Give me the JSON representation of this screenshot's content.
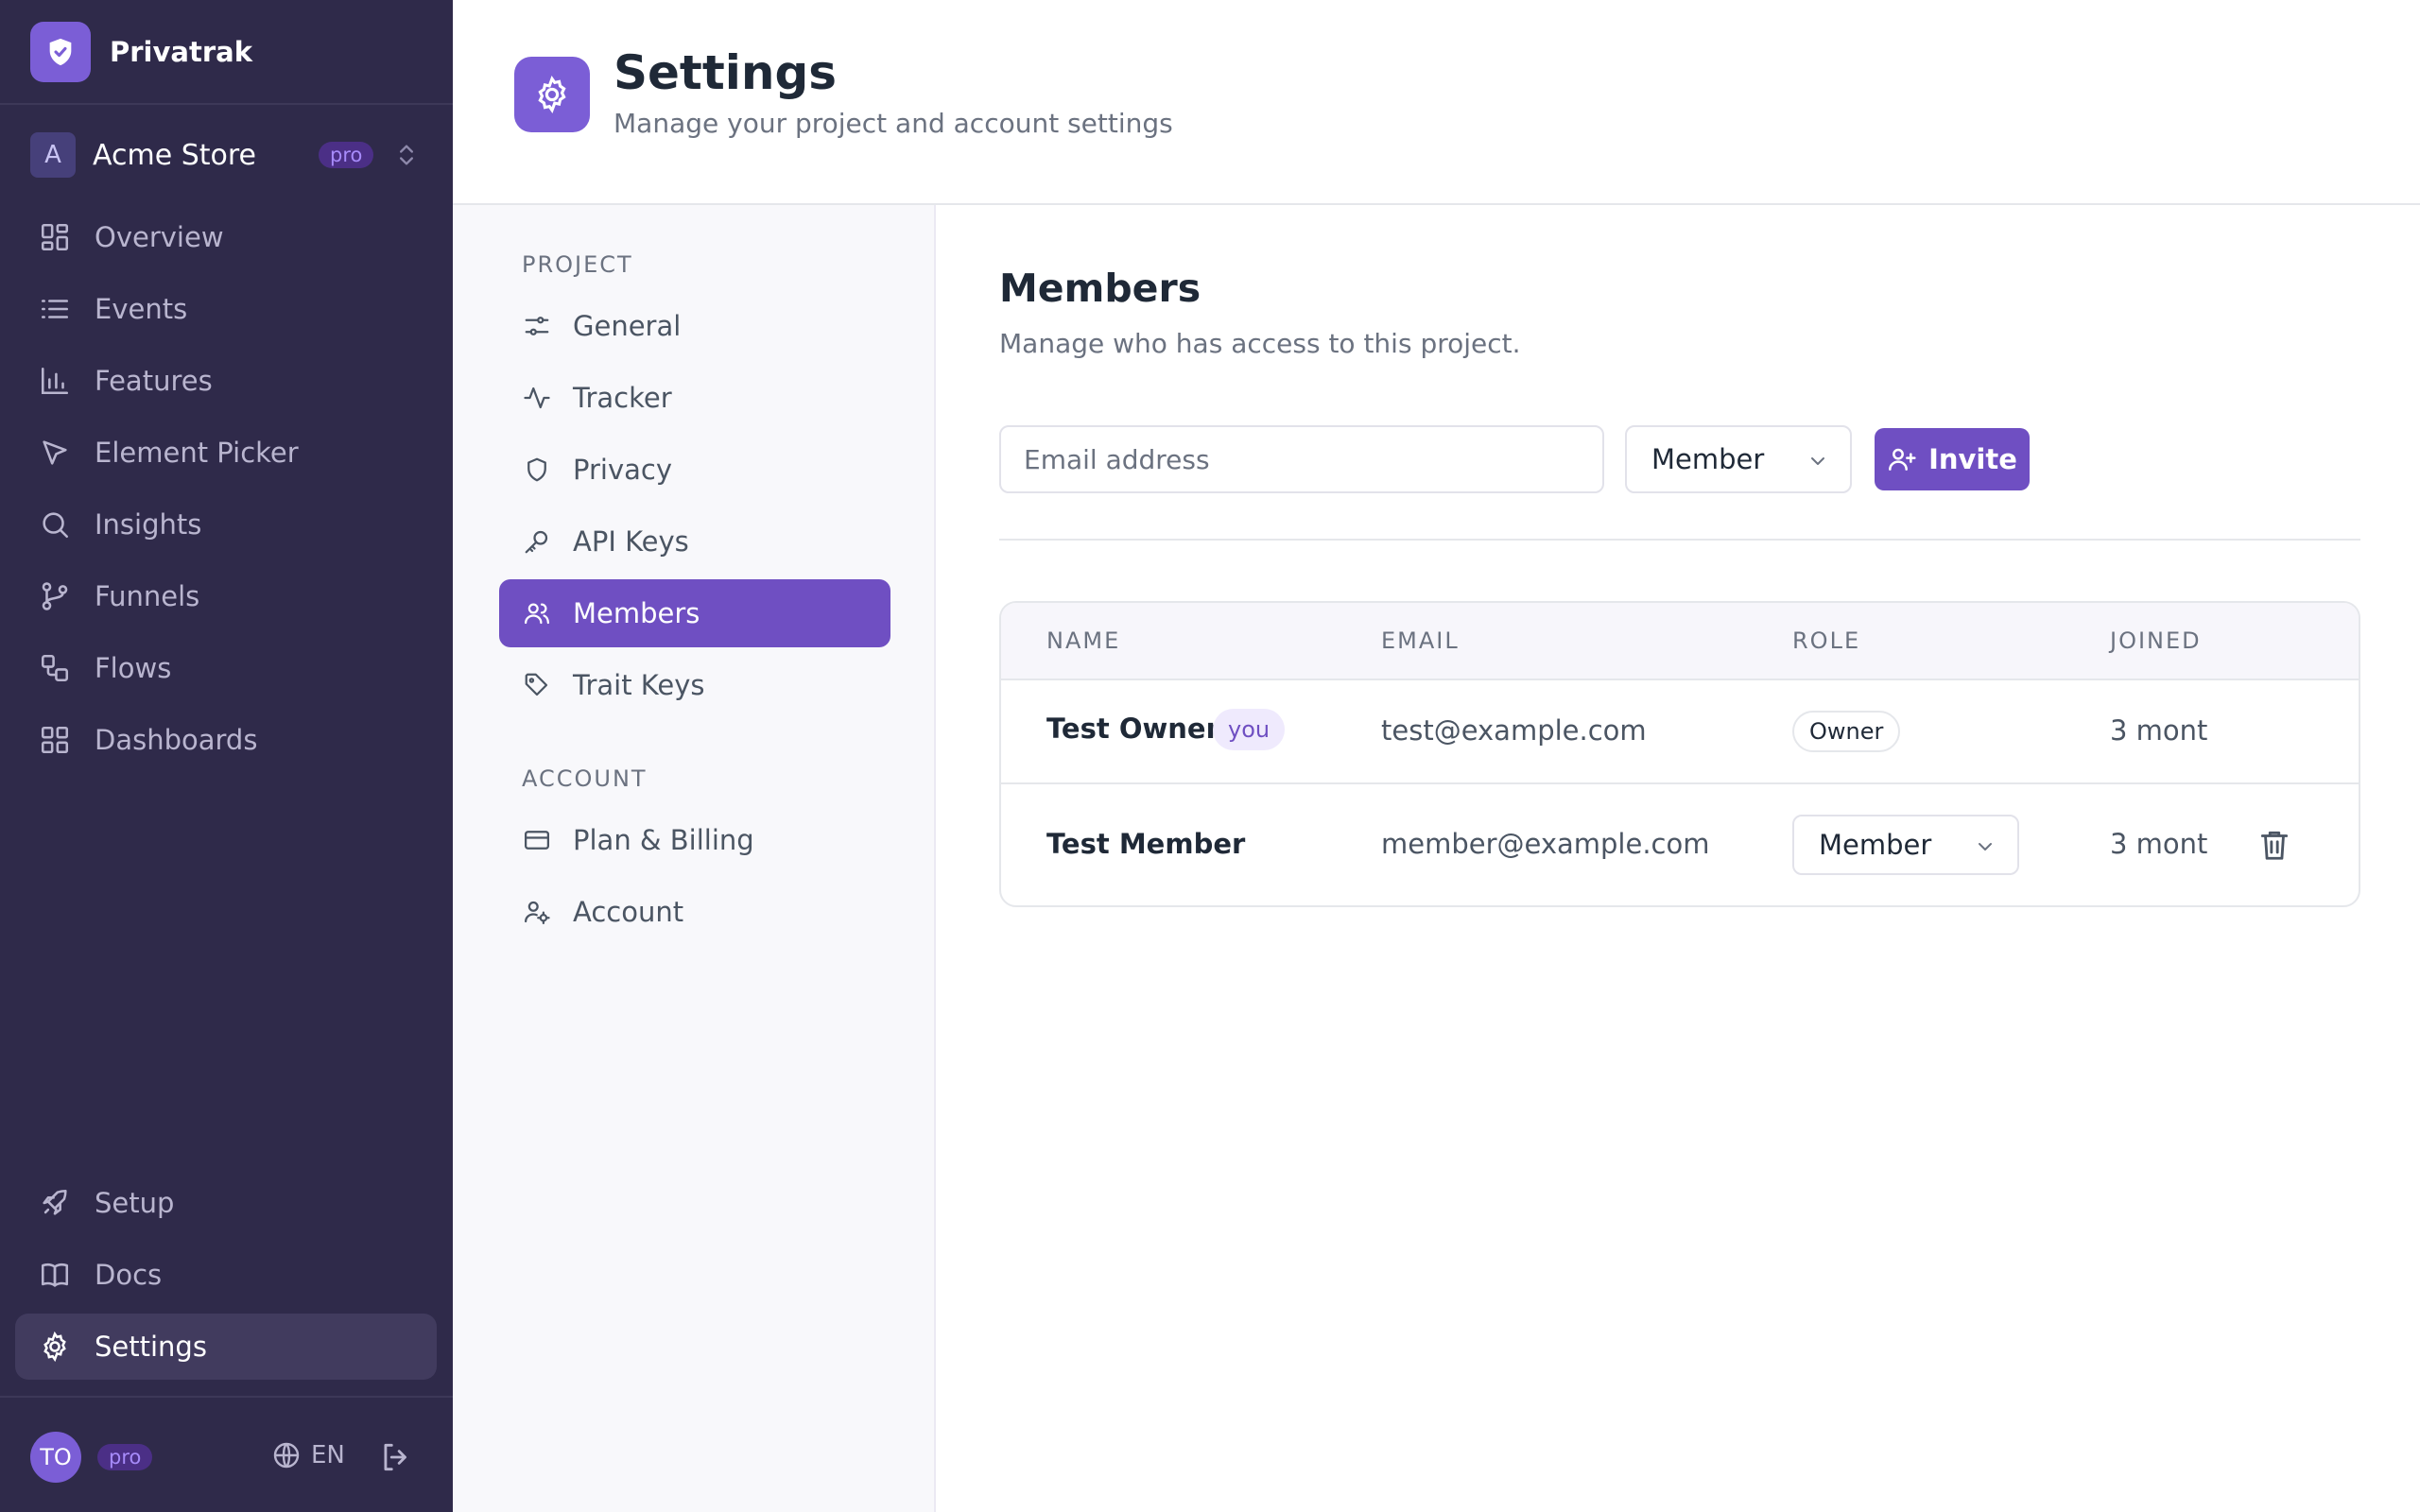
{
  "app": {
    "name": "Privatrak"
  },
  "project": {
    "avatar": "A",
    "name": "Acme Store",
    "plan_badge": "pro"
  },
  "nav": [
    {
      "label": "Overview",
      "icon": "grid-icon"
    },
    {
      "label": "Events",
      "icon": "list-icon"
    },
    {
      "label": "Features",
      "icon": "bar-chart-icon"
    },
    {
      "label": "Element Picker",
      "icon": "cursor-icon"
    },
    {
      "label": "Insights",
      "icon": "search-icon"
    },
    {
      "label": "Funnels",
      "icon": "git-branch-icon"
    },
    {
      "label": "Flows",
      "icon": "workflow-icon"
    },
    {
      "label": "Dashboards",
      "icon": "dashboard-icon"
    }
  ],
  "nav_bottom": [
    {
      "label": "Setup",
      "icon": "rocket-icon"
    },
    {
      "label": "Docs",
      "icon": "book-icon"
    },
    {
      "label": "Settings",
      "icon": "gear-icon",
      "active": true
    }
  ],
  "footer": {
    "user_initials": "TO",
    "plan_badge": "pro",
    "language": "EN"
  },
  "header": {
    "title": "Settings",
    "subtitle": "Manage your project and account settings"
  },
  "settings_nav": {
    "project_heading": "PROJECT",
    "project_items": [
      {
        "label": "General",
        "icon": "sliders-icon"
      },
      {
        "label": "Tracker",
        "icon": "activity-icon"
      },
      {
        "label": "Privacy",
        "icon": "shield-icon"
      },
      {
        "label": "API Keys",
        "icon": "key-icon"
      },
      {
        "label": "Members",
        "icon": "users-icon",
        "active": true
      },
      {
        "label": "Trait Keys",
        "icon": "tag-icon"
      }
    ],
    "account_heading": "ACCOUNT",
    "account_items": [
      {
        "label": "Plan & Billing",
        "icon": "credit-card-icon"
      },
      {
        "label": "Account",
        "icon": "user-cog-icon"
      }
    ]
  },
  "members": {
    "title": "Members",
    "subtitle": "Manage who has access to this project.",
    "email_placeholder": "Email address",
    "role_value": "Member",
    "invite_label": "Invite",
    "columns": [
      "NAME",
      "EMAIL",
      "ROLE",
      "JOINED"
    ],
    "rows": [
      {
        "name": "Test Owner",
        "badge": "you",
        "email": "test@example.com",
        "role": "Owner",
        "joined": "3 mont"
      },
      {
        "name": "Test Member",
        "email": "member@example.com",
        "role": "Member",
        "joined": "3 mont"
      }
    ]
  },
  "colors": {
    "accent": "#6f4fc2",
    "sidebar_bg": "#2f2a4a",
    "brand_logo": "#7b5ed6"
  }
}
